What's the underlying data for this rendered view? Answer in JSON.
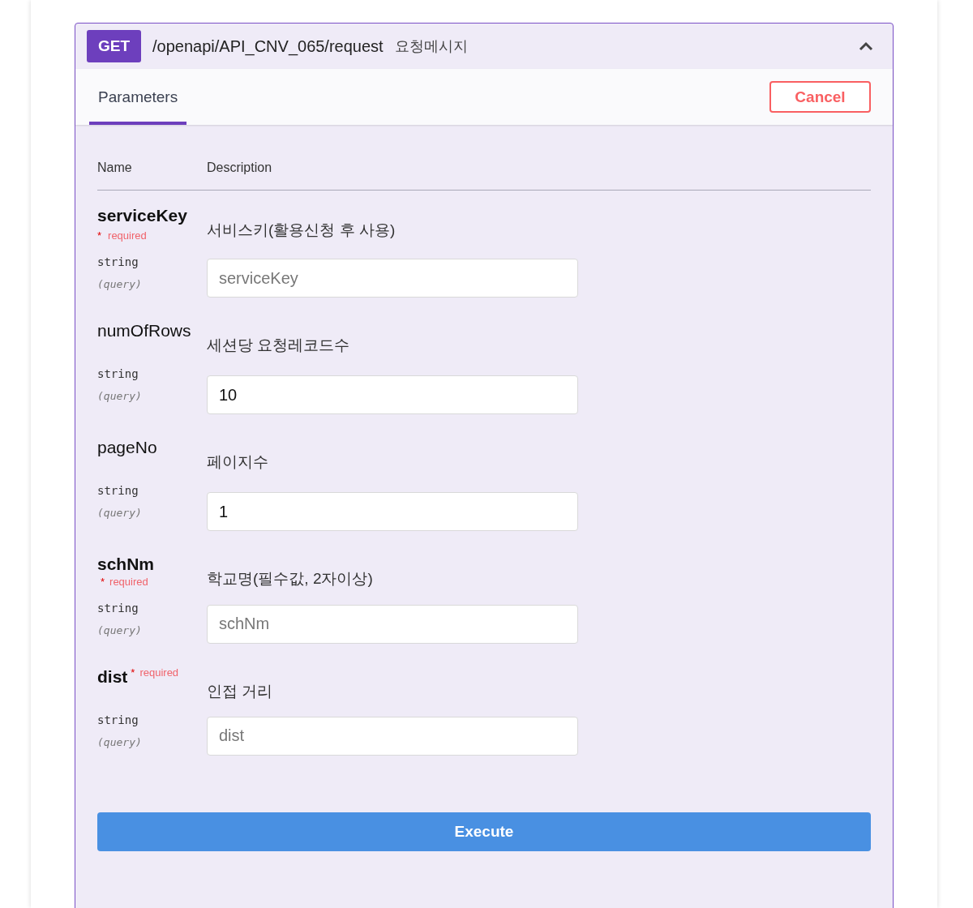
{
  "operation": {
    "method": "GET",
    "path": "/openapi/API_CNV_065/request",
    "summary": "요청메시지",
    "expanded": true
  },
  "tabs": [
    {
      "label": "Parameters",
      "selected": true
    }
  ],
  "cancel_button": "Cancel",
  "table": {
    "columns": [
      "Name",
      "Description"
    ]
  },
  "parameters": [
    {
      "name": "serviceKey",
      "required": true,
      "required_note": {
        "mark": "*",
        "text": "required"
      },
      "type": "string",
      "location": "(query)",
      "description": "서비스키(활용신청 후 사용)",
      "input": {
        "placeholder": "serviceKey"
      }
    },
    {
      "name": "numOfRows",
      "required": false,
      "type": "string",
      "location": "(query)",
      "description": "세션당 요청레코드수",
      "input": {
        "value": "10"
      }
    },
    {
      "name": "pageNo",
      "required": false,
      "type": "string",
      "location": "(query)",
      "description": "페이지수",
      "input": {
        "value": "1"
      }
    },
    {
      "name": "schNm",
      "required": true,
      "required_note": {
        "mark": "*",
        "text": "required"
      },
      "type": "string",
      "location": "(query)",
      "description": "학교명(필수값, 2자이상)",
      "input": {
        "placeholder": "schNm"
      }
    },
    {
      "name": "dist",
      "required": true,
      "required_note": {
        "mark": "*",
        "text": "required"
      },
      "type": "string",
      "location": "(query)",
      "description": "인접 거리",
      "input": {
        "placeholder": "dist"
      }
    }
  ],
  "execute_button": "Execute"
}
